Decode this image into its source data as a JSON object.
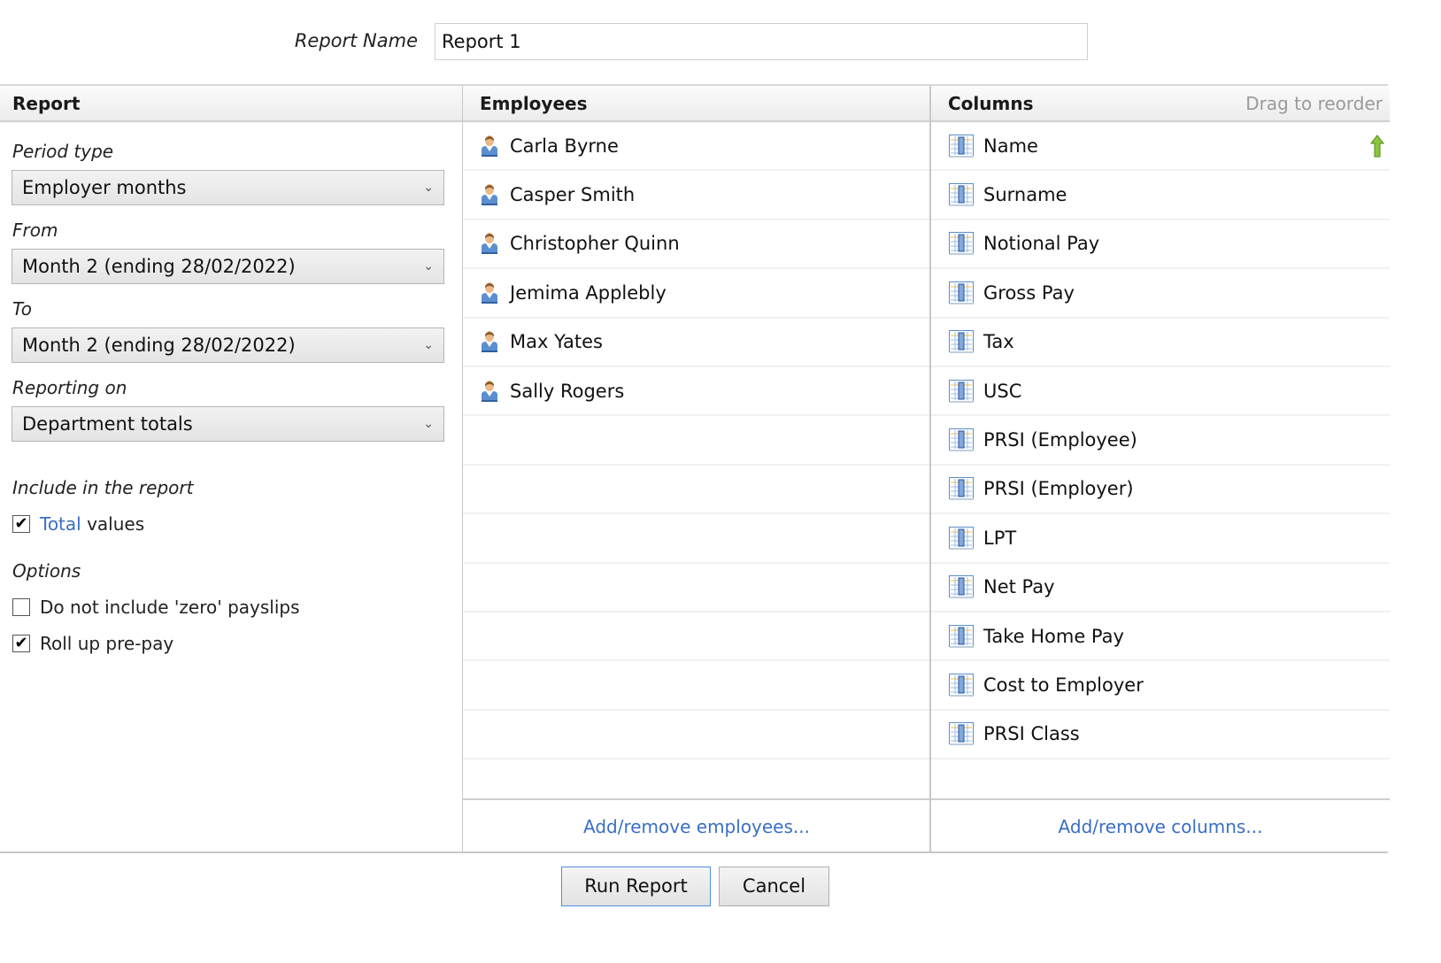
{
  "report_name": {
    "label": "Report Name",
    "value": "Report 1"
  },
  "report_panel": {
    "header": "Report",
    "period_type": {
      "label": "Period type",
      "value": "Employer months"
    },
    "from": {
      "label": "From",
      "value": "Month 2 (ending 28/02/2022)"
    },
    "to": {
      "label": "To",
      "value": "Month 2 (ending 28/02/2022)"
    },
    "reporting_on": {
      "label": "Reporting on",
      "value": "Department totals"
    },
    "include": {
      "label": "Include in the report",
      "total_values": {
        "link": "Total",
        "text": " values",
        "checked": true
      }
    },
    "options": {
      "label": "Options",
      "items": [
        {
          "label": "Do not include 'zero' payslips",
          "checked": false
        },
        {
          "label": "Roll up pre-pay",
          "checked": true
        }
      ]
    }
  },
  "employees_panel": {
    "header": "Employees",
    "items": [
      {
        "name": "Carla Byrne"
      },
      {
        "name": "Casper Smith"
      },
      {
        "name": "Christopher Quinn"
      },
      {
        "name": "Jemima Applebly"
      },
      {
        "name": "Max Yates"
      },
      {
        "name": "Sally Rogers"
      }
    ],
    "footer_link": "Add/remove employees..."
  },
  "columns_panel": {
    "header": "Columns",
    "hint": "Drag to reorder",
    "items": [
      {
        "name": "Name"
      },
      {
        "name": "Surname"
      },
      {
        "name": "Notional Pay"
      },
      {
        "name": "Gross Pay"
      },
      {
        "name": "Tax"
      },
      {
        "name": "USC"
      },
      {
        "name": "PRSI (Employee)"
      },
      {
        "name": "PRSI (Employer)"
      },
      {
        "name": "LPT"
      },
      {
        "name": "Net Pay"
      },
      {
        "name": "Take Home Pay"
      },
      {
        "name": "Cost to Employer"
      },
      {
        "name": "PRSI Class"
      }
    ],
    "footer_link": "Add/remove columns..."
  },
  "buttons": {
    "run": "Run Report",
    "cancel": "Cancel"
  },
  "colors": {
    "link": "#3a6fc4",
    "primary_button_border": "#4f8ee0",
    "arrow_green": "#7cb82f"
  }
}
